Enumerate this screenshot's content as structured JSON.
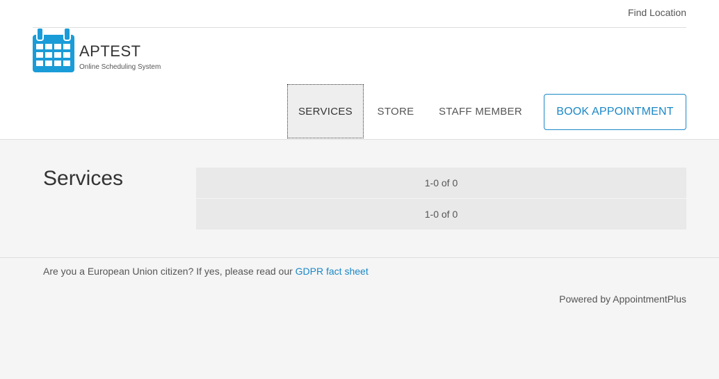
{
  "header": {
    "find_location_label": "Find Location",
    "brand": {
      "name": "APTEST",
      "tagline": "Online Scheduling System",
      "icon": "calendar-icon",
      "icon_color": "#1a9cd8"
    },
    "nav": {
      "services": "SERVICES",
      "store": "STORE",
      "staff_member": "STAFF MEMBER",
      "active": "SERVICES"
    },
    "book_button_label": "BOOK APPOINTMENT",
    "accent_color": "#1a87c6"
  },
  "main": {
    "title": "Services",
    "pager_top": "1-0 of 0",
    "pager_bottom": "1-0 of 0"
  },
  "footer": {
    "gdpr_text": "Are you a European Union citizen? If yes, please read our",
    "gdpr_link": "GDPR fact sheet",
    "powered_by": "Powered by AppointmentPlus"
  }
}
